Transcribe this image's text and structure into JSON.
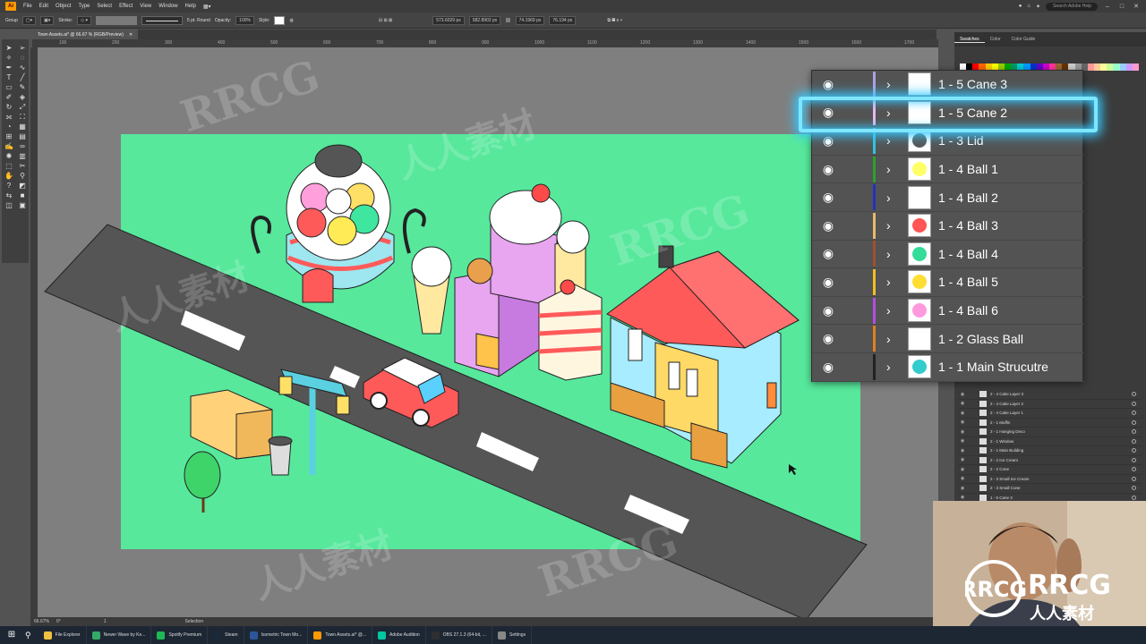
{
  "menubar": {
    "app_logo": "Ai",
    "items": [
      "File",
      "Edit",
      "Object",
      "Type",
      "Select",
      "Effect",
      "View",
      "Window",
      "Help"
    ],
    "search_placeholder": "Search Adobe Help"
  },
  "controlbar": {
    "group_label": "Group",
    "stroke_label": "Stroke:",
    "brush_label": "5 pt. Round",
    "opacity_label": "Opacity:",
    "opacity_value": "100%",
    "style_label": "Style:",
    "x_value": "573.6029 px",
    "y_value": "582.8902 px",
    "w_value": "74.1969 px",
    "h_value": "76.194 px"
  },
  "document_tab": {
    "title": "Town Assets.ai* @ 66.67 % (RGB/Preview)",
    "close_icon": "close-icon"
  },
  "ruler_marks": [
    "100",
    "200",
    "300",
    "400",
    "500",
    "600",
    "700",
    "800",
    "900",
    "1000",
    "1100",
    "1200",
    "1300",
    "1400",
    "1500",
    "1600",
    "1700"
  ],
  "right_panel": {
    "tabs": [
      "Swatches",
      "Color",
      "Color Guide"
    ],
    "swatch_colors": [
      "#ffffff",
      "#000000",
      "#ff0000",
      "#ff6600",
      "#ffcc00",
      "#ffff00",
      "#99cc00",
      "#00aa00",
      "#009966",
      "#00cccc",
      "#0099ff",
      "#0033cc",
      "#6600cc",
      "#cc00cc",
      "#ff3399",
      "#996633",
      "#663300",
      "#cccccc",
      "#999999",
      "#666666",
      "#ff9999",
      "#ffcc99",
      "#ffff99",
      "#ccff99",
      "#99ffcc",
      "#99ccff",
      "#cc99ff",
      "#ff99cc"
    ],
    "small_layers": [
      "2 - 4 Cake Layer 3",
      "2 - 4 Cake Layer 2",
      "2 - 4 Cake Layer 1",
      "2 - 1 Muffin",
      "2 - 1 Hanging Deco",
      "2 - 1 Window",
      "2 - 1 Main Building",
      "2 - 2 Ice Cream",
      "2 - 2 Cone",
      "2 - 3 Small Ice Cream",
      "2 - 3 Small Cone",
      "1 - 5 Cane 3"
    ]
  },
  "layers_zoom": [
    {
      "name": "1 - 5 Cane 3",
      "color": "#b0a0e0",
      "thumb": "#ffffff"
    },
    {
      "name": "1 - 5 Cane 2",
      "color": "#e6b8f0",
      "thumb": "#ffffff"
    },
    {
      "name": "1 - 3 Lid",
      "color": "#2ec4e0",
      "thumb": "#555555"
    },
    {
      "name": "1 - 4 Ball 1",
      "color": "#2ea02e",
      "thumb": "#ffff66"
    },
    {
      "name": "1 - 4 Ball 2",
      "color": "#2233bb",
      "thumb": "#ffffff"
    },
    {
      "name": "1 - 4 Ball 3",
      "color": "#e8b86a",
      "thumb": "#ff5555"
    },
    {
      "name": "1 - 4 Ball 4",
      "color": "#a0522d",
      "thumb": "#33dd99"
    },
    {
      "name": "1 - 4 Ball 5",
      "color": "#f0c020",
      "thumb": "#ffdd33"
    },
    {
      "name": "1 - 4 Ball 6",
      "color": "#b050e0",
      "thumb": "#ff99dd"
    },
    {
      "name": "1 - 2 Glass Ball",
      "color": "#e08020",
      "thumb": "#ffffff"
    },
    {
      "name": "1 - 1 Main Strucutre",
      "color": "#222222",
      "thumb": "#33cccc"
    }
  ],
  "statusbar": {
    "zoom": "66.67%",
    "rotation": "0°",
    "artboard": "1",
    "tool": "Selection"
  },
  "taskbar": {
    "items": [
      {
        "label": "File Explorer",
        "color": "#f0c040"
      },
      {
        "label": "Newer Wave by Ke...",
        "color": "#33aa66"
      },
      {
        "label": "Spotify Premium",
        "color": "#1db954"
      },
      {
        "label": "Steam",
        "color": "#1b2838"
      },
      {
        "label": "Isometric Town Mo...",
        "color": "#2b579a"
      },
      {
        "label": "Town Assets.ai* @...",
        "color": "#ff9a00"
      },
      {
        "label": "Adobe Audition",
        "color": "#00c8a0"
      },
      {
        "label": "OBS 27.1.3 (64-bit, ...",
        "color": "#302e31"
      },
      {
        "label": "Settings",
        "color": "#888888"
      }
    ]
  },
  "watermarks": [
    "RRCG",
    "人人素材"
  ],
  "brand": {
    "logo": "RRCG",
    "subtitle": "人人素材"
  }
}
